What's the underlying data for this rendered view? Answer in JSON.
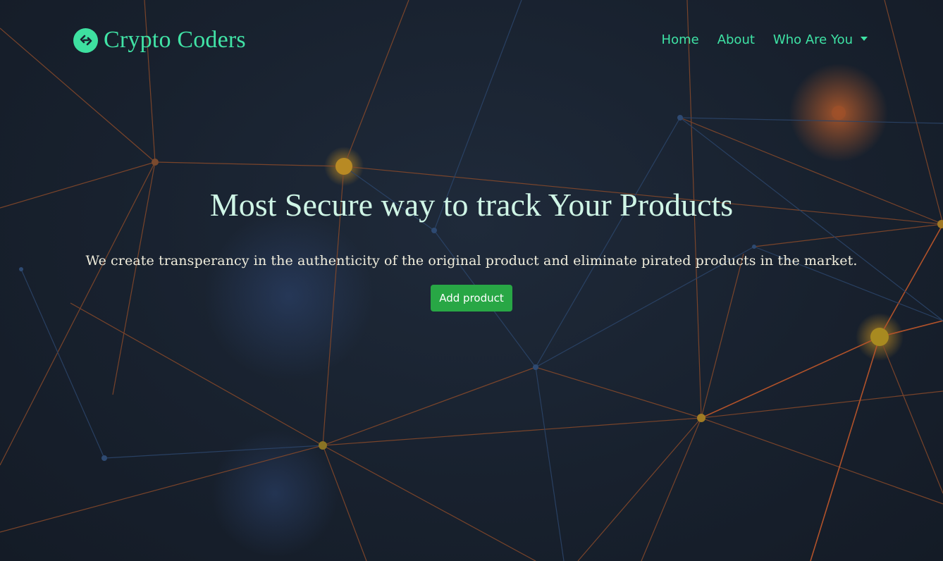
{
  "brand": {
    "name": "Crypto Coders",
    "logo_icon": "chain-link-icon",
    "color": "#41e3a6"
  },
  "nav": {
    "items": [
      {
        "label": "Home"
      },
      {
        "label": "About"
      },
      {
        "label": "Who Are You"
      }
    ],
    "dropdown_icon": "caret-down-icon"
  },
  "hero": {
    "title": "Most Secure way to track Your Products",
    "subtitle": "We create transperancy in the authenticity of the original product and eliminate pirated products in the market.",
    "button_label": "Add product",
    "button_color": "#28a745"
  },
  "colors": {
    "background": "#18212e",
    "accent": "#3ee3a5",
    "network_orange": "#c0602a",
    "network_gold": "#c9a227",
    "network_blue": "#2a4a7a"
  }
}
